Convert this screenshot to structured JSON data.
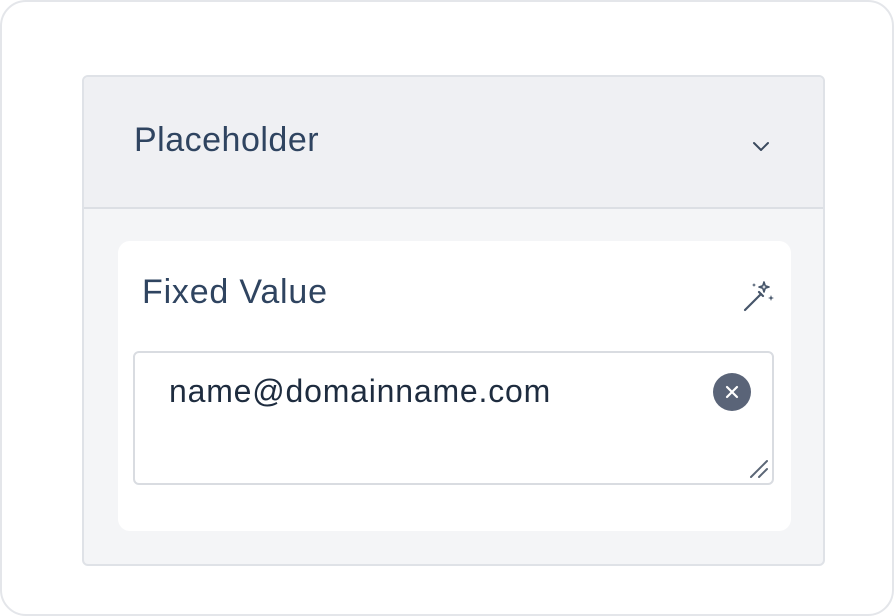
{
  "section": {
    "title": "Placeholder",
    "toggle_icon": "chevron-down-icon"
  },
  "field": {
    "label": "Fixed Value",
    "magic_icon": "magic-wand-icon",
    "value": "name@domainname.com",
    "clear_icon": "clear-icon",
    "resize_icon": "resize-handle-icon"
  },
  "colors": {
    "title_text": "#2f4460",
    "header_bg": "#eff0f3",
    "panel_bg": "#f4f5f7",
    "clear_button": "#5a6478"
  }
}
